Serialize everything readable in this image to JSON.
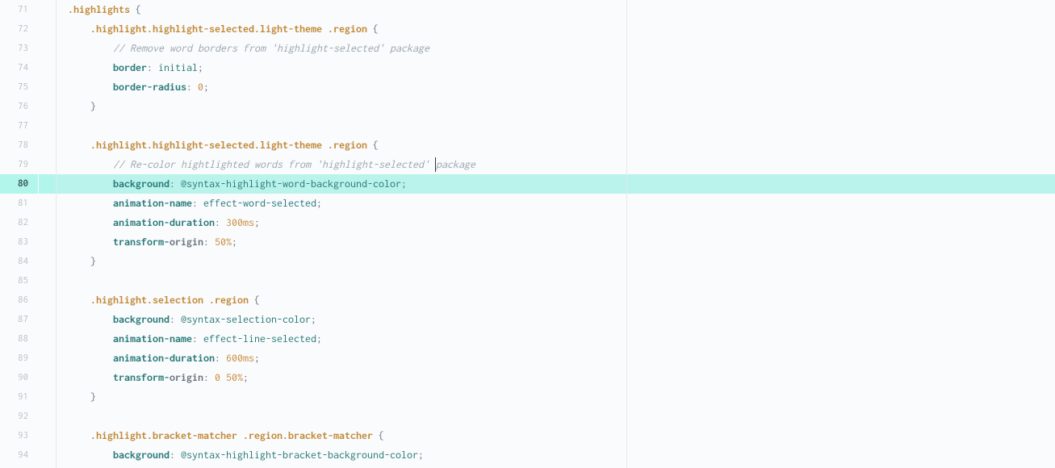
{
  "editor": {
    "first_line_number": 71,
    "current_line_index": 9,
    "cursor": {
      "line_index": 8,
      "after_token": 0
    },
    "ruler_column": 80,
    "lines": [
      {
        "indent": 0,
        "tokens": [
          {
            "cls": "sel",
            "t": ".highlights"
          },
          {
            "cls": "plain",
            "t": " "
          },
          {
            "cls": "brace",
            "t": "{"
          }
        ]
      },
      {
        "indent": 1,
        "tokens": [
          {
            "cls": "sel",
            "t": ".highlight.highlight-selected.light-theme"
          },
          {
            "cls": "plain",
            "t": " "
          },
          {
            "cls": "sel",
            "t": ".region"
          },
          {
            "cls": "plain",
            "t": " "
          },
          {
            "cls": "brace",
            "t": "{"
          }
        ]
      },
      {
        "indent": 2,
        "tokens": [
          {
            "cls": "cmt",
            "t": "// Remove word borders from 'highlight-selected' package"
          }
        ]
      },
      {
        "indent": 2,
        "tokens": [
          {
            "cls": "prop",
            "t": "border"
          },
          {
            "cls": "punct",
            "t": ": "
          },
          {
            "cls": "val",
            "t": "initial"
          },
          {
            "cls": "punct",
            "t": ";"
          }
        ]
      },
      {
        "indent": 2,
        "tokens": [
          {
            "cls": "prop",
            "t": "border-radius"
          },
          {
            "cls": "punct",
            "t": ": "
          },
          {
            "cls": "num",
            "t": "0"
          },
          {
            "cls": "punct",
            "t": ";"
          }
        ]
      },
      {
        "indent": 1,
        "tokens": [
          {
            "cls": "brace",
            "t": "}"
          }
        ]
      },
      {
        "indent": 0,
        "tokens": []
      },
      {
        "indent": 1,
        "tokens": [
          {
            "cls": "sel",
            "t": ".highlight.highlight-selected.light-theme"
          },
          {
            "cls": "plain",
            "t": " "
          },
          {
            "cls": "sel",
            "t": ".region"
          },
          {
            "cls": "plain",
            "t": " "
          },
          {
            "cls": "brace",
            "t": "{"
          }
        ]
      },
      {
        "indent": 2,
        "tokens": [
          {
            "cls": "cmt",
            "t": "// Re-color hightlighted words from 'highlight-selected' "
          },
          {
            "cls": "cursor",
            "t": ""
          },
          {
            "cls": "cmt",
            "t": "package"
          }
        ]
      },
      {
        "indent": 2,
        "tokens": [
          {
            "cls": "prop",
            "t": "background"
          },
          {
            "cls": "punct",
            "t": ": "
          },
          {
            "cls": "var",
            "t": "@syntax-highlight-word-background-color"
          },
          {
            "cls": "punct",
            "t": ";"
          }
        ]
      },
      {
        "indent": 2,
        "tokens": [
          {
            "cls": "prop",
            "t": "animation-name"
          },
          {
            "cls": "punct",
            "t": ": "
          },
          {
            "cls": "val",
            "t": "effect-word-selected"
          },
          {
            "cls": "punct",
            "t": ";"
          }
        ]
      },
      {
        "indent": 2,
        "tokens": [
          {
            "cls": "prop",
            "t": "animation-duration"
          },
          {
            "cls": "punct",
            "t": ": "
          },
          {
            "cls": "num",
            "t": "300ms"
          },
          {
            "cls": "punct",
            "t": ";"
          }
        ]
      },
      {
        "indent": 2,
        "tokens": [
          {
            "cls": "prop",
            "t": "transform-"
          },
          {
            "cls": "prop2",
            "t": "origin"
          },
          {
            "cls": "punct",
            "t": ": "
          },
          {
            "cls": "num",
            "t": "50%"
          },
          {
            "cls": "punct",
            "t": ";"
          }
        ]
      },
      {
        "indent": 1,
        "tokens": [
          {
            "cls": "brace",
            "t": "}"
          }
        ]
      },
      {
        "indent": 0,
        "tokens": []
      },
      {
        "indent": 1,
        "tokens": [
          {
            "cls": "sel",
            "t": ".highlight.selection"
          },
          {
            "cls": "plain",
            "t": " "
          },
          {
            "cls": "sel",
            "t": ".region"
          },
          {
            "cls": "plain",
            "t": " "
          },
          {
            "cls": "brace",
            "t": "{"
          }
        ]
      },
      {
        "indent": 2,
        "tokens": [
          {
            "cls": "prop",
            "t": "background"
          },
          {
            "cls": "punct",
            "t": ": "
          },
          {
            "cls": "var",
            "t": "@syntax-selection-color"
          },
          {
            "cls": "punct",
            "t": ";"
          }
        ]
      },
      {
        "indent": 2,
        "tokens": [
          {
            "cls": "prop",
            "t": "animation-name"
          },
          {
            "cls": "punct",
            "t": ": "
          },
          {
            "cls": "val",
            "t": "effect-line-selected"
          },
          {
            "cls": "punct",
            "t": ";"
          }
        ]
      },
      {
        "indent": 2,
        "tokens": [
          {
            "cls": "prop",
            "t": "animation-duration"
          },
          {
            "cls": "punct",
            "t": ": "
          },
          {
            "cls": "num",
            "t": "600ms"
          },
          {
            "cls": "punct",
            "t": ";"
          }
        ]
      },
      {
        "indent": 2,
        "tokens": [
          {
            "cls": "prop",
            "t": "transform-"
          },
          {
            "cls": "prop2",
            "t": "origin"
          },
          {
            "cls": "punct",
            "t": ": "
          },
          {
            "cls": "num",
            "t": "0"
          },
          {
            "cls": "plain",
            "t": " "
          },
          {
            "cls": "num",
            "t": "50%"
          },
          {
            "cls": "punct",
            "t": ";"
          }
        ]
      },
      {
        "indent": 1,
        "tokens": [
          {
            "cls": "brace",
            "t": "}"
          }
        ]
      },
      {
        "indent": 0,
        "tokens": []
      },
      {
        "indent": 1,
        "tokens": [
          {
            "cls": "sel",
            "t": ".highlight.bracket-matcher"
          },
          {
            "cls": "plain",
            "t": " "
          },
          {
            "cls": "sel",
            "t": ".region.bracket-matcher"
          },
          {
            "cls": "plain",
            "t": " "
          },
          {
            "cls": "brace",
            "t": "{"
          }
        ]
      },
      {
        "indent": 2,
        "tokens": [
          {
            "cls": "prop",
            "t": "background"
          },
          {
            "cls": "punct",
            "t": ": "
          },
          {
            "cls": "var",
            "t": "@syntax-highlight-bracket-background-color"
          },
          {
            "cls": "punct",
            "t": ";"
          }
        ]
      }
    ]
  }
}
